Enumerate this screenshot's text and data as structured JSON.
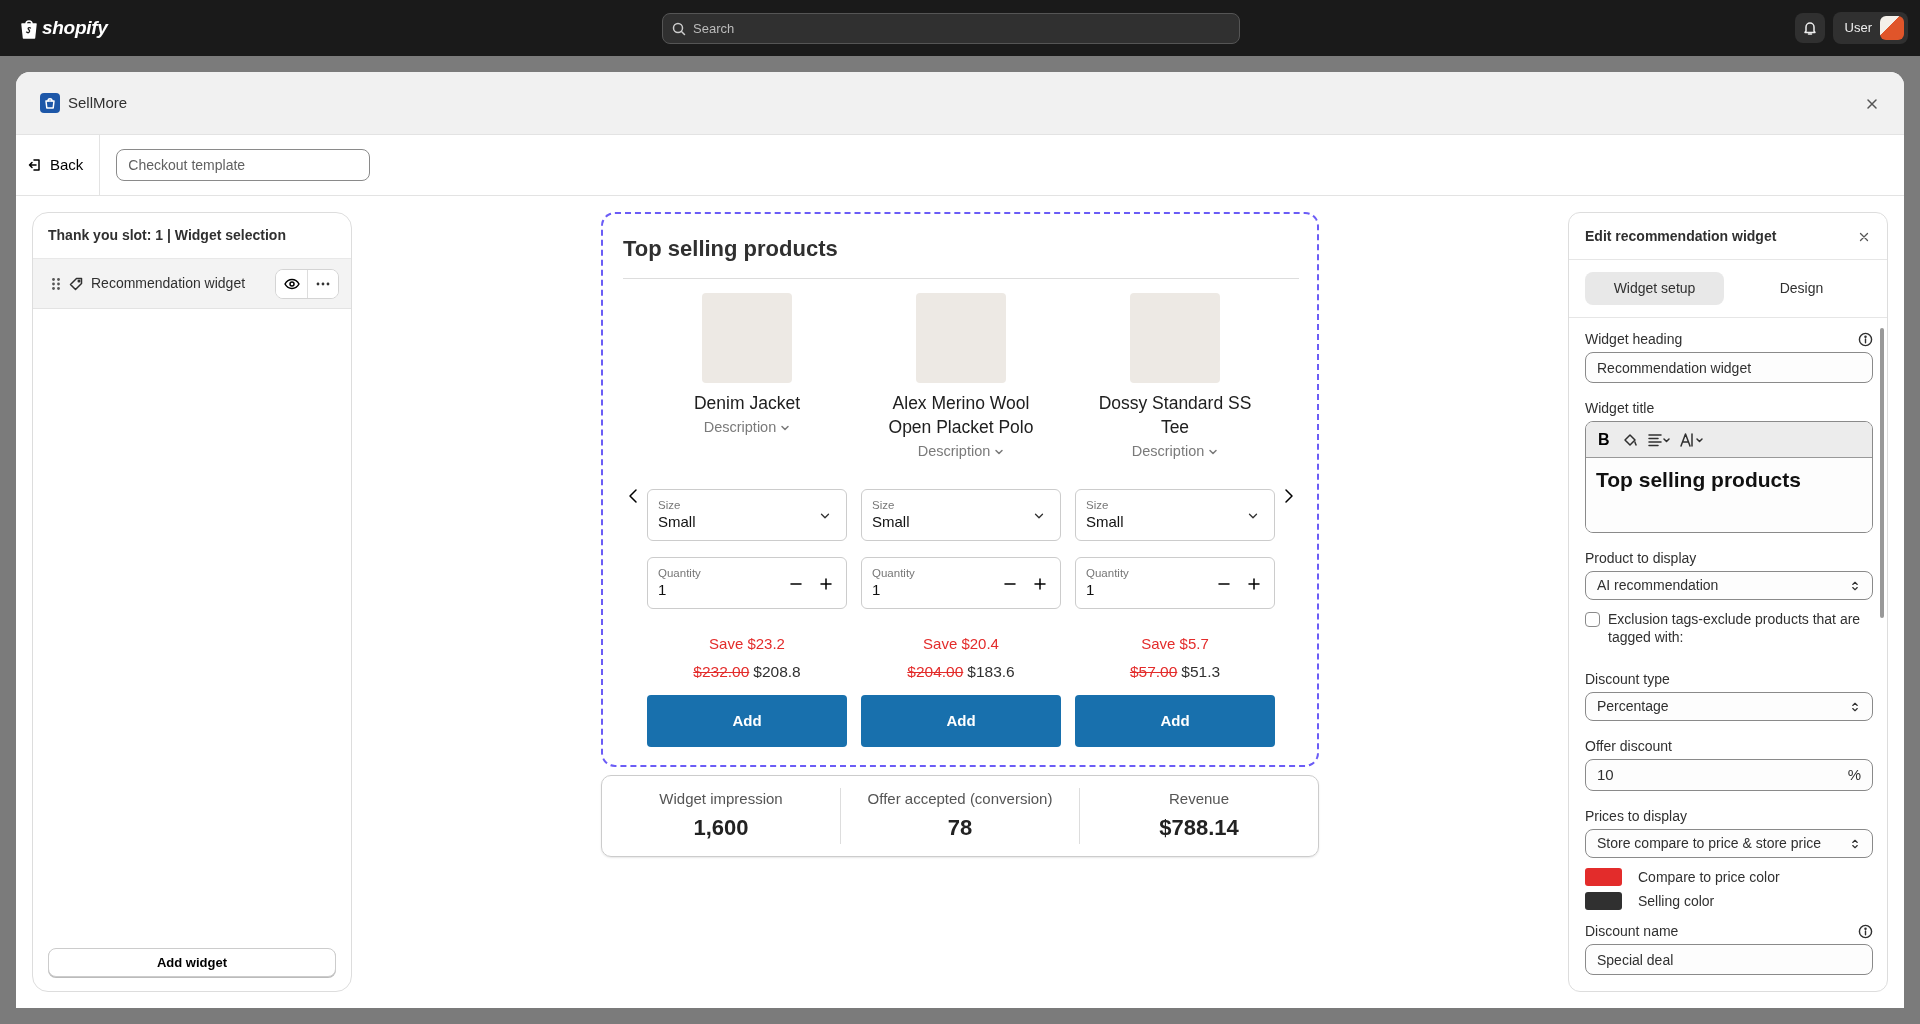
{
  "top_bar": {
    "logo": "shopify",
    "search": {
      "placeholder": "Search"
    },
    "user": "User"
  },
  "app": {
    "title": "SellMore"
  },
  "toolbar": {
    "back": "Back",
    "template_field": {
      "placeholder": "Checkout template"
    }
  },
  "widget_list": {
    "title": "Thank you slot: 1 | Widget selection",
    "items": [
      {
        "label": "Recommendation widget",
        "selected": true
      }
    ],
    "add_button": "Add widget"
  },
  "preview": {
    "heading": "Top selling products",
    "products": [
      {
        "name": "Denim Jacket",
        "description": "Description",
        "size_label": "Size",
        "size": "Small",
        "quantity_label": "Quantity",
        "quantity": "1",
        "save": "Save $23.2",
        "compare_price": "$232.00",
        "price": "$208.8",
        "button": "Add"
      },
      {
        "name": "Alex Merino Wool Open Placket Polo",
        "description": "Description",
        "size_label": "Size",
        "size": "Small",
        "quantity_label": "Quantity",
        "quantity": "1",
        "save": "Save $20.4",
        "compare_price": "$204.00",
        "price": "$183.6",
        "button": "Add"
      },
      {
        "name": "Dossy Standard SS Tee",
        "description": "Description",
        "size_label": "Size",
        "size": "Small",
        "quantity_label": "Quantity",
        "quantity": "1",
        "save": "Save $5.7",
        "compare_price": "$57.00",
        "price": "$51.3",
        "button": "Add"
      }
    ]
  },
  "stats": [
    {
      "label": "Widget impression",
      "value": "1,600"
    },
    {
      "label": "Offer accepted (conversion)",
      "value": "78"
    },
    {
      "label": "Revenue",
      "value": "$788.14"
    }
  ],
  "editor": {
    "title": "Edit recommendation widget",
    "tabs": [
      {
        "label": "Widget setup",
        "selected": true
      },
      {
        "label": "Design",
        "selected": false
      }
    ],
    "fields": [
      {
        "kind": "text",
        "label": "Widget heading",
        "info": true,
        "value": "Recommendation widget"
      },
      {
        "kind": "richtext",
        "label": "Widget title",
        "bold_button": "B",
        "value": "Top selling products"
      },
      {
        "kind": "select",
        "label": "Product to display",
        "value": "AI recommendation"
      },
      {
        "kind": "checkbox",
        "label": "Exclusion tags-exclude products that are tagged with:",
        "checked": false
      },
      {
        "kind": "select",
        "label": "Discount type",
        "value": "Percentage"
      },
      {
        "kind": "suffix",
        "label": "Offer discount",
        "value": "10",
        "suffix": "%"
      },
      {
        "kind": "select",
        "label": "Prices to display",
        "value": "Store compare to price & store price"
      },
      {
        "kind": "color",
        "label": "Compare to price color",
        "color": "#e32c2b"
      },
      {
        "kind": "color",
        "label": "Selling color",
        "color": "#303030"
      },
      {
        "kind": "text",
        "label": "Discount name",
        "info": true,
        "value": "Special deal"
      }
    ]
  }
}
